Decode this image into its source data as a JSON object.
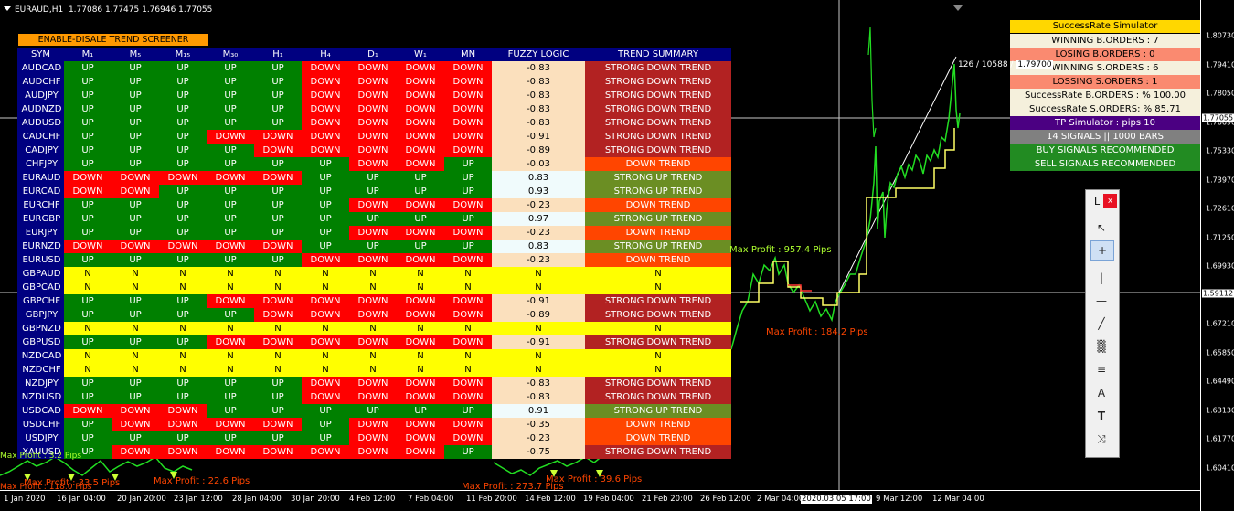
{
  "header": {
    "symbol": "EURAUD,H1",
    "ohlc": "1.77086 1.77475 1.76946 1.77055"
  },
  "screener": {
    "toggle_label": "ENABLE-DISALE TREND SCREENER",
    "headers": [
      "SYM",
      "M₁",
      "M₅",
      "M₁₅",
      "M₃₀",
      "H₁",
      "H₄",
      "D₁",
      "W₁",
      "MN",
      "FUZZY LOGIC",
      "TREND SUMMARY"
    ],
    "rows": [
      {
        "sym": "AUDCAD",
        "tf": [
          "UP",
          "UP",
          "UP",
          "UP",
          "UP",
          "DOWN",
          "DOWN",
          "DOWN",
          "DOWN"
        ],
        "fuzzy": "-0.83",
        "trend": "STRONG DOWN TREND"
      },
      {
        "sym": "AUDCHF",
        "tf": [
          "UP",
          "UP",
          "UP",
          "UP",
          "UP",
          "DOWN",
          "DOWN",
          "DOWN",
          "DOWN"
        ],
        "fuzzy": "-0.83",
        "trend": "STRONG DOWN TREND"
      },
      {
        "sym": "AUDJPY",
        "tf": [
          "UP",
          "UP",
          "UP",
          "UP",
          "UP",
          "DOWN",
          "DOWN",
          "DOWN",
          "DOWN"
        ],
        "fuzzy": "-0.83",
        "trend": "STRONG DOWN TREND"
      },
      {
        "sym": "AUDNZD",
        "tf": [
          "UP",
          "UP",
          "UP",
          "UP",
          "UP",
          "DOWN",
          "DOWN",
          "DOWN",
          "DOWN"
        ],
        "fuzzy": "-0.83",
        "trend": "STRONG DOWN TREND"
      },
      {
        "sym": "AUDUSD",
        "tf": [
          "UP",
          "UP",
          "UP",
          "UP",
          "UP",
          "DOWN",
          "DOWN",
          "DOWN",
          "DOWN"
        ],
        "fuzzy": "-0.83",
        "trend": "STRONG DOWN TREND"
      },
      {
        "sym": "CADCHF",
        "tf": [
          "UP",
          "UP",
          "UP",
          "DOWN",
          "DOWN",
          "DOWN",
          "DOWN",
          "DOWN",
          "DOWN"
        ],
        "fuzzy": "-0.91",
        "trend": "STRONG DOWN TREND"
      },
      {
        "sym": "CADJPY",
        "tf": [
          "UP",
          "UP",
          "UP",
          "UP",
          "DOWN",
          "DOWN",
          "DOWN",
          "DOWN",
          "DOWN"
        ],
        "fuzzy": "-0.89",
        "trend": "STRONG DOWN TREND"
      },
      {
        "sym": "CHFJPY",
        "tf": [
          "UP",
          "UP",
          "UP",
          "UP",
          "UP",
          "UP",
          "DOWN",
          "DOWN",
          "UP"
        ],
        "fuzzy": "-0.03",
        "trend": "DOWN TREND"
      },
      {
        "sym": "EURAUD",
        "tf": [
          "DOWN",
          "DOWN",
          "DOWN",
          "DOWN",
          "DOWN",
          "UP",
          "UP",
          "UP",
          "UP"
        ],
        "fuzzy": "0.83",
        "trend": "STRONG UP TREND"
      },
      {
        "sym": "EURCAD",
        "tf": [
          "DOWN",
          "DOWN",
          "UP",
          "UP",
          "UP",
          "UP",
          "UP",
          "UP",
          "UP"
        ],
        "fuzzy": "0.93",
        "trend": "STRONG UP TREND"
      },
      {
        "sym": "EURCHF",
        "tf": [
          "UP",
          "UP",
          "UP",
          "UP",
          "UP",
          "UP",
          "DOWN",
          "DOWN",
          "DOWN"
        ],
        "fuzzy": "-0.23",
        "trend": "DOWN TREND"
      },
      {
        "sym": "EURGBP",
        "tf": [
          "UP",
          "UP",
          "UP",
          "UP",
          "UP",
          "UP",
          "UP",
          "UP",
          "UP"
        ],
        "fuzzy": "0.97",
        "trend": "STRONG UP TREND"
      },
      {
        "sym": "EURJPY",
        "tf": [
          "UP",
          "UP",
          "UP",
          "UP",
          "UP",
          "UP",
          "DOWN",
          "DOWN",
          "DOWN"
        ],
        "fuzzy": "-0.23",
        "trend": "DOWN TREND"
      },
      {
        "sym": "EURNZD",
        "tf": [
          "DOWN",
          "DOWN",
          "DOWN",
          "DOWN",
          "DOWN",
          "UP",
          "UP",
          "UP",
          "UP"
        ],
        "fuzzy": "0.83",
        "trend": "STRONG UP TREND"
      },
      {
        "sym": "EURUSD",
        "tf": [
          "UP",
          "UP",
          "UP",
          "UP",
          "UP",
          "DOWN",
          "DOWN",
          "DOWN",
          "DOWN"
        ],
        "fuzzy": "-0.23",
        "trend": "DOWN TREND"
      },
      {
        "sym": "GBPAUD",
        "tf": [
          "N",
          "N",
          "N",
          "N",
          "N",
          "N",
          "N",
          "N",
          "N"
        ],
        "fuzzy": "N",
        "trend": "N"
      },
      {
        "sym": "GBPCAD",
        "tf": [
          "N",
          "N",
          "N",
          "N",
          "N",
          "N",
          "N",
          "N",
          "N"
        ],
        "fuzzy": "N",
        "trend": "N"
      },
      {
        "sym": "GBPCHF",
        "tf": [
          "UP",
          "UP",
          "UP",
          "DOWN",
          "DOWN",
          "DOWN",
          "DOWN",
          "DOWN",
          "DOWN"
        ],
        "fuzzy": "-0.91",
        "trend": "STRONG DOWN TREND"
      },
      {
        "sym": "GBPJPY",
        "tf": [
          "UP",
          "UP",
          "UP",
          "UP",
          "DOWN",
          "DOWN",
          "DOWN",
          "DOWN",
          "DOWN"
        ],
        "fuzzy": "-0.89",
        "trend": "STRONG DOWN TREND"
      },
      {
        "sym": "GBPNZD",
        "tf": [
          "N",
          "N",
          "N",
          "N",
          "N",
          "N",
          "N",
          "N",
          "N"
        ],
        "fuzzy": "N",
        "trend": "N"
      },
      {
        "sym": "GBPUSD",
        "tf": [
          "UP",
          "UP",
          "UP",
          "DOWN",
          "DOWN",
          "DOWN",
          "DOWN",
          "DOWN",
          "DOWN"
        ],
        "fuzzy": "-0.91",
        "trend": "STRONG DOWN TREND"
      },
      {
        "sym": "NZDCAD",
        "tf": [
          "N",
          "N",
          "N",
          "N",
          "N",
          "N",
          "N",
          "N",
          "N"
        ],
        "fuzzy": "N",
        "trend": "N"
      },
      {
        "sym": "NZDCHF",
        "tf": [
          "N",
          "N",
          "N",
          "N",
          "N",
          "N",
          "N",
          "N",
          "N"
        ],
        "fuzzy": "N",
        "trend": "N"
      },
      {
        "sym": "NZDJPY",
        "tf": [
          "UP",
          "UP",
          "UP",
          "UP",
          "UP",
          "DOWN",
          "DOWN",
          "DOWN",
          "DOWN"
        ],
        "fuzzy": "-0.83",
        "trend": "STRONG DOWN TREND"
      },
      {
        "sym": "NZDUSD",
        "tf": [
          "UP",
          "UP",
          "UP",
          "UP",
          "UP",
          "DOWN",
          "DOWN",
          "DOWN",
          "DOWN"
        ],
        "fuzzy": "-0.83",
        "trend": "STRONG DOWN TREND"
      },
      {
        "sym": "USDCAD",
        "tf": [
          "DOWN",
          "DOWN",
          "DOWN",
          "UP",
          "UP",
          "UP",
          "UP",
          "UP",
          "UP"
        ],
        "fuzzy": "0.91",
        "trend": "STRONG UP TREND"
      },
      {
        "sym": "USDCHF",
        "tf": [
          "UP",
          "DOWN",
          "DOWN",
          "DOWN",
          "DOWN",
          "UP",
          "DOWN",
          "DOWN",
          "DOWN"
        ],
        "fuzzy": "-0.35",
        "trend": "DOWN TREND"
      },
      {
        "sym": "USDJPY",
        "tf": [
          "UP",
          "UP",
          "UP",
          "UP",
          "UP",
          "UP",
          "DOWN",
          "DOWN",
          "DOWN"
        ],
        "fuzzy": "-0.23",
        "trend": "DOWN TREND"
      },
      {
        "sym": "XAUUSD",
        "tf": [
          "UP",
          "DOWN",
          "DOWN",
          "DOWN",
          "DOWN",
          "DOWN",
          "DOWN",
          "DOWN",
          "UP"
        ],
        "fuzzy": "-0.75",
        "trend": "STRONG DOWN TREND"
      }
    ]
  },
  "simulator": {
    "title": "SuccessRate Simulator",
    "winning_buy": "WINNING B.ORDERS : 7",
    "losing_buy": "LOSING B.ORDERS : 0",
    "winning_sell": "WINNING S.ORDERS : 6",
    "losing_sell": "LOSSING S.ORDERS : 1",
    "rate_buy": "SuccessRate B.ORDERS : % 100.00",
    "rate_sell": "SuccessRate S.ORDERS: % 85.71",
    "tp": "TP Simulator : pips 10",
    "signals": "14 SIGNALS || 1000 BARS",
    "buy_rec": "BUY SIGNALS RECOMMENDED",
    "sell_rec": "SELL SIGNALS RECOMMENDED"
  },
  "chart": {
    "y_ticks": [
      "1.80730",
      "1.79410",
      "1.78050",
      "1.76690",
      "1.75330",
      "1.73970",
      "1.72610",
      "1.71250",
      "1.69930",
      "1.68570",
      "1.67210",
      "1.65850",
      "1.64490",
      "1.63130",
      "1.61770",
      "1.60410"
    ],
    "price_tag_current": "1.77055",
    "price_tag_cursor": "1.59112",
    "x_ticks": [
      "1 Jan 2020",
      "16 Jan 04:00",
      "20 Jan 20:00",
      "23 Jan 12:00",
      "28 Jan 04:00",
      "30 Jan 20:00",
      "4 Feb 12:00",
      "7 Feb 04:00",
      "11 Feb 20:00",
      "14 Feb 12:00",
      "19 Feb 04:00",
      "21 Feb 20:00",
      "26 Feb 12:00",
      "2 Mar 04:00",
      "9 Mar 12:00",
      "12 Mar 04:00"
    ],
    "x_cursor_tag": "2020.03.05 17:00",
    "crosshair_label": "126 / 10588 / ",
    "crosshair_value": "1.79700",
    "profit_labels": [
      {
        "text": "Max Profit : 957.4 Pips",
        "color": "green"
      },
      {
        "text": "Max Profit : 184.2 Pips",
        "color": "red"
      },
      {
        "text": "Max Profit : 33.5 Pips",
        "color": "red"
      },
      {
        "text": "Max Profit : 22.6 Pips",
        "color": "red"
      },
      {
        "text": "Max Profit : 273.7 Pips",
        "color": "red"
      },
      {
        "text": "Max Profit : 39.6 Pips",
        "color": "red"
      },
      {
        "text": "Max Profit : 3.2 Pips",
        "color": "green"
      },
      {
        "text": "Max Profit : 118.0 Pips",
        "color": "red"
      }
    ]
  },
  "toolbox": {
    "title": "L",
    "close": "x"
  }
}
